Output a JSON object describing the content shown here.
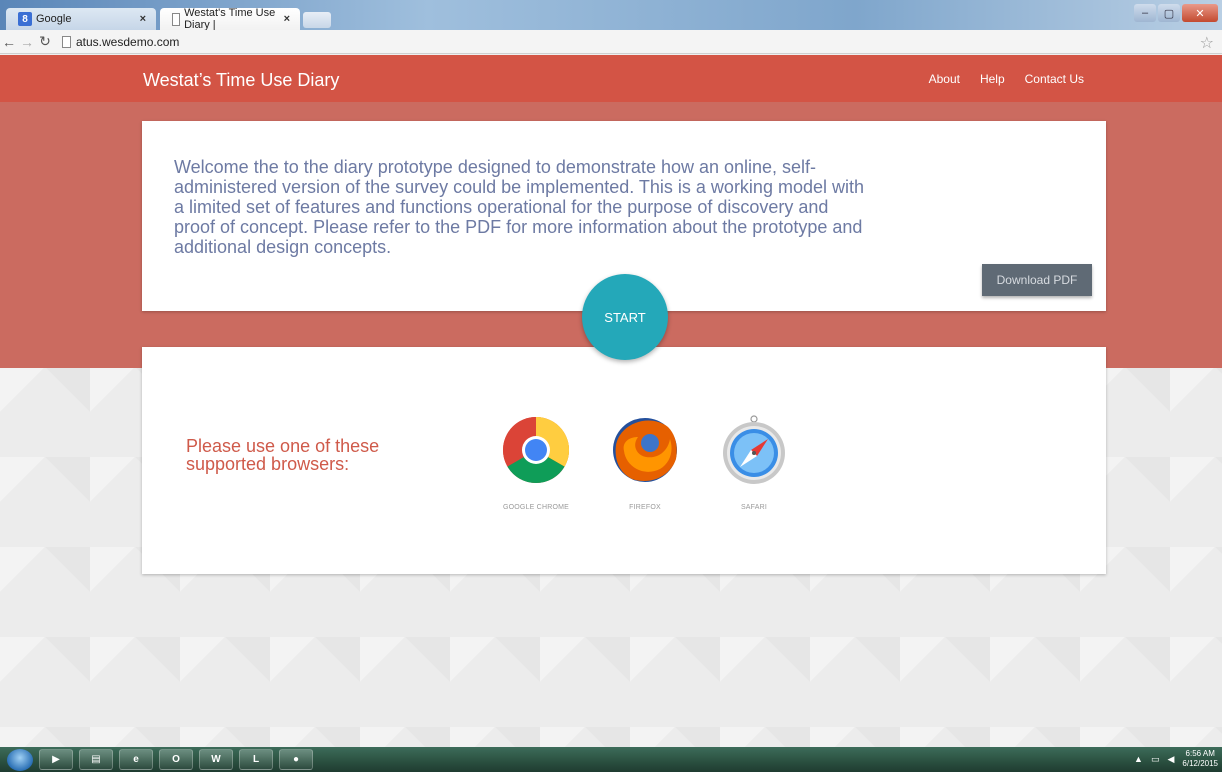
{
  "browser": {
    "tabs": [
      {
        "label": "Google",
        "icon": "google-icon"
      },
      {
        "label": "Westat's Time Use Diary |",
        "icon": "document-icon"
      }
    ],
    "close_glyph": "×",
    "url": "atus.wesdemo.com",
    "window_controls": [
      "minimize",
      "maximize",
      "close"
    ]
  },
  "header": {
    "brand": "Westat’s Time Use Diary",
    "nav": [
      "About",
      "Help",
      "Contact Us"
    ]
  },
  "intro": {
    "text": "Welcome the to the diary prototype designed to demonstrate how an online, self-administered version of the survey could be implemented. This is a working model with a limited set of features and functions operational for the purpose of discovery and proof of concept. Please refer to the PDF for more information about the prototype and additional design concepts.",
    "download_label": "Download PDF",
    "start_label": "START"
  },
  "browsers_section": {
    "prompt": "Please use one of these supported browsers:",
    "items": [
      {
        "name": "GOOGLE CHROME",
        "icon": "chrome-icon"
      },
      {
        "name": "FIREFOX",
        "icon": "firefox-icon"
      },
      {
        "name": "SAFARI",
        "icon": "safari-icon"
      }
    ]
  },
  "taskbar": {
    "time": "6:56 AM",
    "date": "6/12/2015"
  },
  "colors": {
    "header": "#d35445",
    "band": "#cb6b60",
    "start_button": "#24a8b9",
    "download_button": "#5f6a75",
    "intro_text": "#6d7aa3",
    "prompt_text": "#cf5a4a"
  }
}
